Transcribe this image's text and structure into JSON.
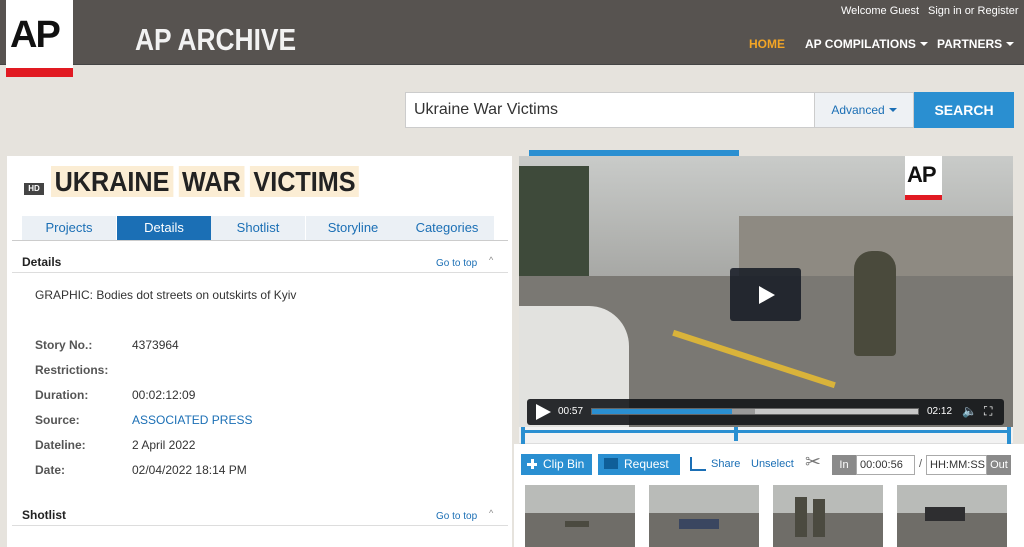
{
  "header": {
    "logo_text": "AP",
    "brand": "AP ARCHIVE",
    "welcome": "Welcome  Guest",
    "signin": "Sign in or Register",
    "nav": {
      "home": "HOME",
      "compilations": "AP COMPILATIONS",
      "partners": "PARTNERS"
    }
  },
  "search": {
    "value": "Ukraine War Victims",
    "advanced_label": "Advanced",
    "button_label": "SEARCH"
  },
  "story": {
    "hd_badge": "HD",
    "title_words": [
      "UKRAINE",
      "WAR",
      "VICTIMS"
    ],
    "tabs": [
      "Projects",
      "Details",
      "Shotlist",
      "Storyline",
      "Categories"
    ],
    "active_tab": "Details",
    "details_heading": "Details",
    "go_to_top": "Go to top",
    "summary": "GRAPHIC: Bodies dot streets on outskirts of Kyiv",
    "fields": {
      "story_no_label": "Story No.:",
      "story_no": "4373964",
      "restrictions_label": "Restrictions:",
      "restrictions": "",
      "duration_label": "Duration:",
      "duration": "00:02:12:09",
      "source_label": "Source:",
      "source": "ASSOCIATED PRESS",
      "dateline_label": "Dateline:",
      "dateline": "2 April 2022",
      "date_label": "Date:",
      "date": "02/04/2022 18:14 PM"
    },
    "shotlist_heading": "Shotlist"
  },
  "player": {
    "watermark": "AP",
    "current_time": "00:57",
    "duration": "02:12",
    "progress": 0.43,
    "buffered": 0.5,
    "clip_marker": 0.44
  },
  "tools": {
    "clip_bin": "Clip Bin",
    "request": "Request",
    "share": "Share",
    "unselect": "Unselect",
    "in_label": "In",
    "in_value": "00:00:56",
    "slash": "/",
    "out_value": "HH:MM:SS",
    "out_label": "Out"
  },
  "colors": {
    "accent": "#2a8fd1",
    "link": "#1b6fb5",
    "home_active": "#f3a525",
    "ap_red": "#e11a22",
    "title_highlight": "#fbedd4"
  }
}
